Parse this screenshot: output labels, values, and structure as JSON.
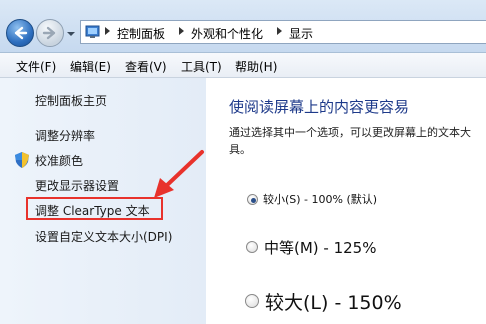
{
  "breadcrumb": {
    "items": [
      "控制面板",
      "外观和个性化",
      "显示"
    ]
  },
  "menu": {
    "items": [
      "文件(F)",
      "编辑(E)",
      "查看(V)",
      "工具(T)",
      "帮助(H)"
    ]
  },
  "sidebar": {
    "home": "控制面板主页",
    "links": [
      "调整分辨率",
      "校准颜色",
      "更改显示器设置",
      "调整 ClearType 文本",
      "设置自定义文本大小(DPI)"
    ],
    "highlighted_index": 3,
    "highlight_color": "#e8322c"
  },
  "main": {
    "title": "使阅读屏幕上的内容更容易",
    "description_line1": "通过选择其中一个选项，可以更改屏幕上的文本大",
    "description_line2": "具。",
    "options": [
      {
        "label": "较小(S) - 100% (默认)",
        "checked": true
      },
      {
        "label": "中等(M) - 125%",
        "checked": false
      },
      {
        "label": "较大(L) - 150%",
        "checked": false
      }
    ]
  },
  "icons": {
    "back": "back-arrow-icon",
    "forward": "forward-arrow-icon",
    "control_panel": "control-panel-icon",
    "shield": "uac-shield-icon"
  },
  "colors": {
    "title_blue": "#1e3a8a",
    "sidebar_bg": "#eef4fb",
    "accent_red": "#e8322c"
  }
}
